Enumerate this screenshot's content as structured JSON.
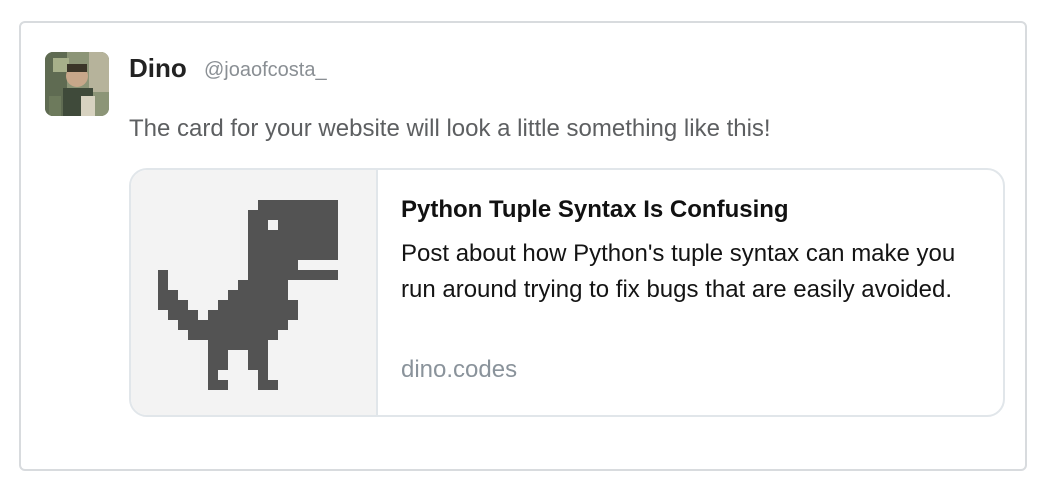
{
  "tweet": {
    "author": {
      "name": "Dino",
      "handle": "@joaofcosta_"
    },
    "text": "The card for your website will look a little something like this!",
    "card": {
      "image_icon": "dino-icon",
      "title": "Python Tuple Syntax Is Confusing",
      "description": "Post about how Python's tuple syntax can make you run around trying to fix bugs that are easily avoided.",
      "domain": "dino.codes"
    }
  },
  "colors": {
    "dino": "#535353",
    "card_media_bg": "#f3f3f3",
    "border": "#e1e6ea",
    "muted_text": "#8a939b"
  }
}
